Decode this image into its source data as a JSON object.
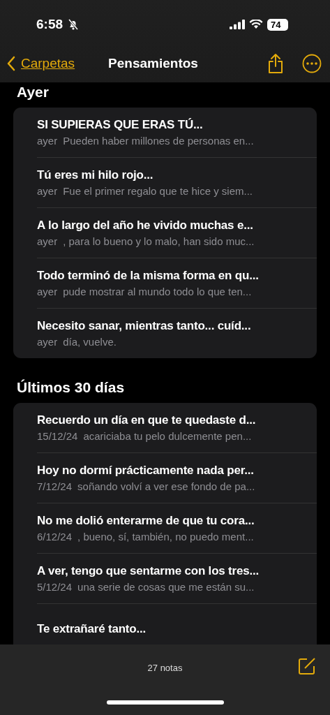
{
  "status_bar": {
    "time": "6:58",
    "silent": true,
    "battery": "74"
  },
  "nav": {
    "back": "Carpetas",
    "title": "Pensamientos"
  },
  "sections": [
    {
      "heading": "Ayer",
      "notes": [
        {
          "title": "SI SUPIERAS QUE ERAS TÚ...",
          "date": "ayer",
          "preview": "Pueden haber millones de personas en..."
        },
        {
          "title": "Tú eres mi hilo rojo...",
          "date": "ayer",
          "preview": "Fue el primer regalo que te hice y siem..."
        },
        {
          "title": "A lo largo del año he vivido muchas e...",
          "date": "ayer",
          "preview": ", para lo bueno y lo malo, han sido muc..."
        },
        {
          "title": "Todo terminó de la misma forma en qu...",
          "date": "ayer",
          "preview": "pude mostrar al mundo todo lo que ten..."
        },
        {
          "title": "Necesito sanar, mientras tanto... cuíd...",
          "date": "ayer",
          "preview": "día, vuelve."
        }
      ]
    },
    {
      "heading": "Últimos 30 días",
      "notes": [
        {
          "title": "Recuerdo un día en que te quedaste d...",
          "date": "15/12/24",
          "preview": "acariciaba tu pelo dulcemente pen..."
        },
        {
          "title": "Hoy no dormí prácticamente nada per...",
          "date": "7/12/24",
          "preview": "soñando volví a ver ese fondo de pa..."
        },
        {
          "title": "No me dolió enterarme de que tu cora...",
          "date": "6/12/24",
          "preview": ", bueno, sí, también, no puedo ment..."
        },
        {
          "title": "A ver, tengo que sentarme con los tres...",
          "date": "5/12/24",
          "preview": "una serie de cosas que me están su..."
        },
        {
          "title": "Te extrañaré tanto..."
        }
      ]
    }
  ],
  "bottom_bar": {
    "count": "27 notas"
  }
}
